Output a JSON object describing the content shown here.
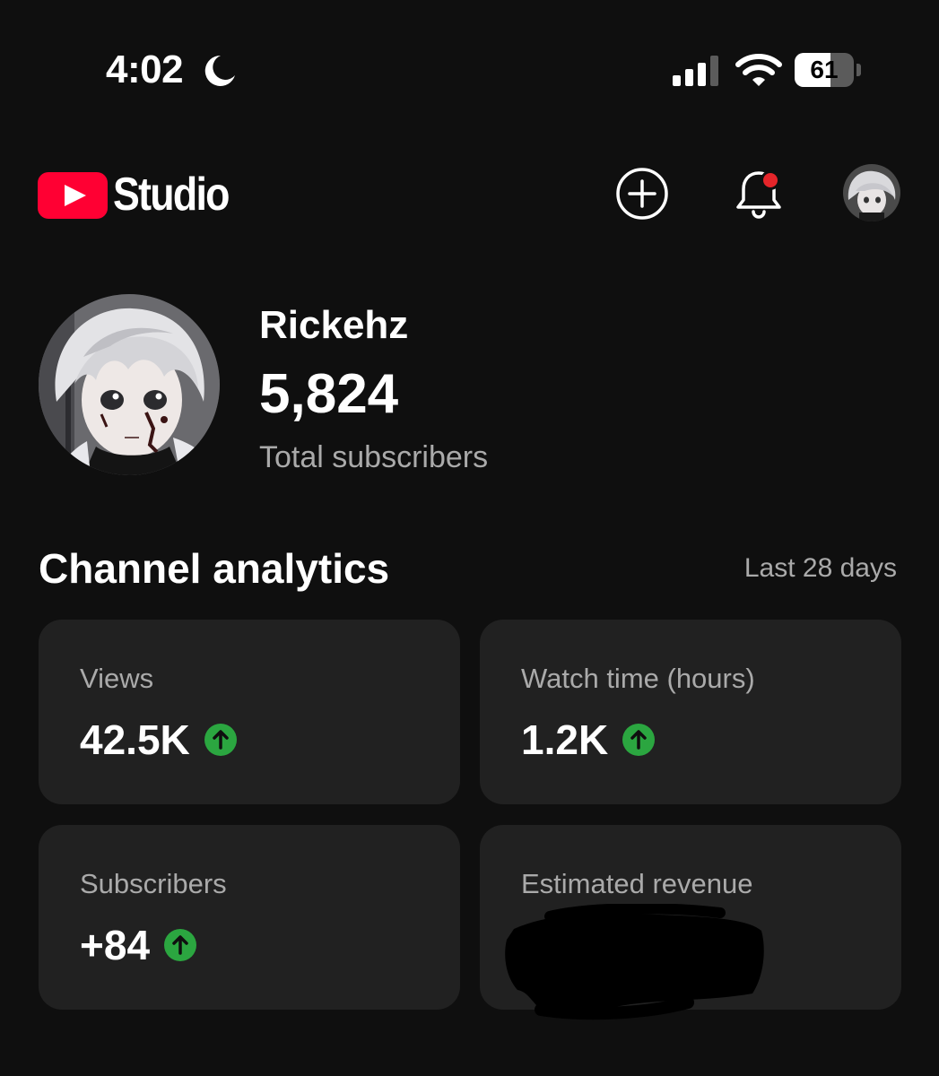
{
  "status_bar": {
    "time": "4:02",
    "battery_level": "61",
    "battery_fraction": 0.61,
    "icons": [
      "moon-icon",
      "signal-icon",
      "wifi-icon",
      "battery-icon"
    ]
  },
  "header": {
    "brand": "Studio",
    "icons": [
      "youtube-logo-icon",
      "create-plus-icon",
      "bell-icon",
      "account-avatar"
    ],
    "notification_dot_color": "#e5252a"
  },
  "channel": {
    "name": "Rickehz",
    "subscriber_count": "5,824",
    "subscriber_caption": "Total subscribers"
  },
  "analytics": {
    "title": "Channel analytics",
    "period": "Last 28 days",
    "trend_color": "#2ba640",
    "cards": [
      {
        "label": "Views",
        "value": "42.5K",
        "trend": "up"
      },
      {
        "label": "Watch time (hours)",
        "value": "1.2K",
        "trend": "up"
      },
      {
        "label": "Subscribers",
        "value": "+84",
        "trend": "up"
      },
      {
        "label": "Estimated revenue",
        "value": "",
        "redacted": true
      }
    ]
  },
  "colors": {
    "background": "#0f0f0f",
    "card": "#212121",
    "brand_red": "#ff0033",
    "secondary_text": "#aaaaaa"
  }
}
